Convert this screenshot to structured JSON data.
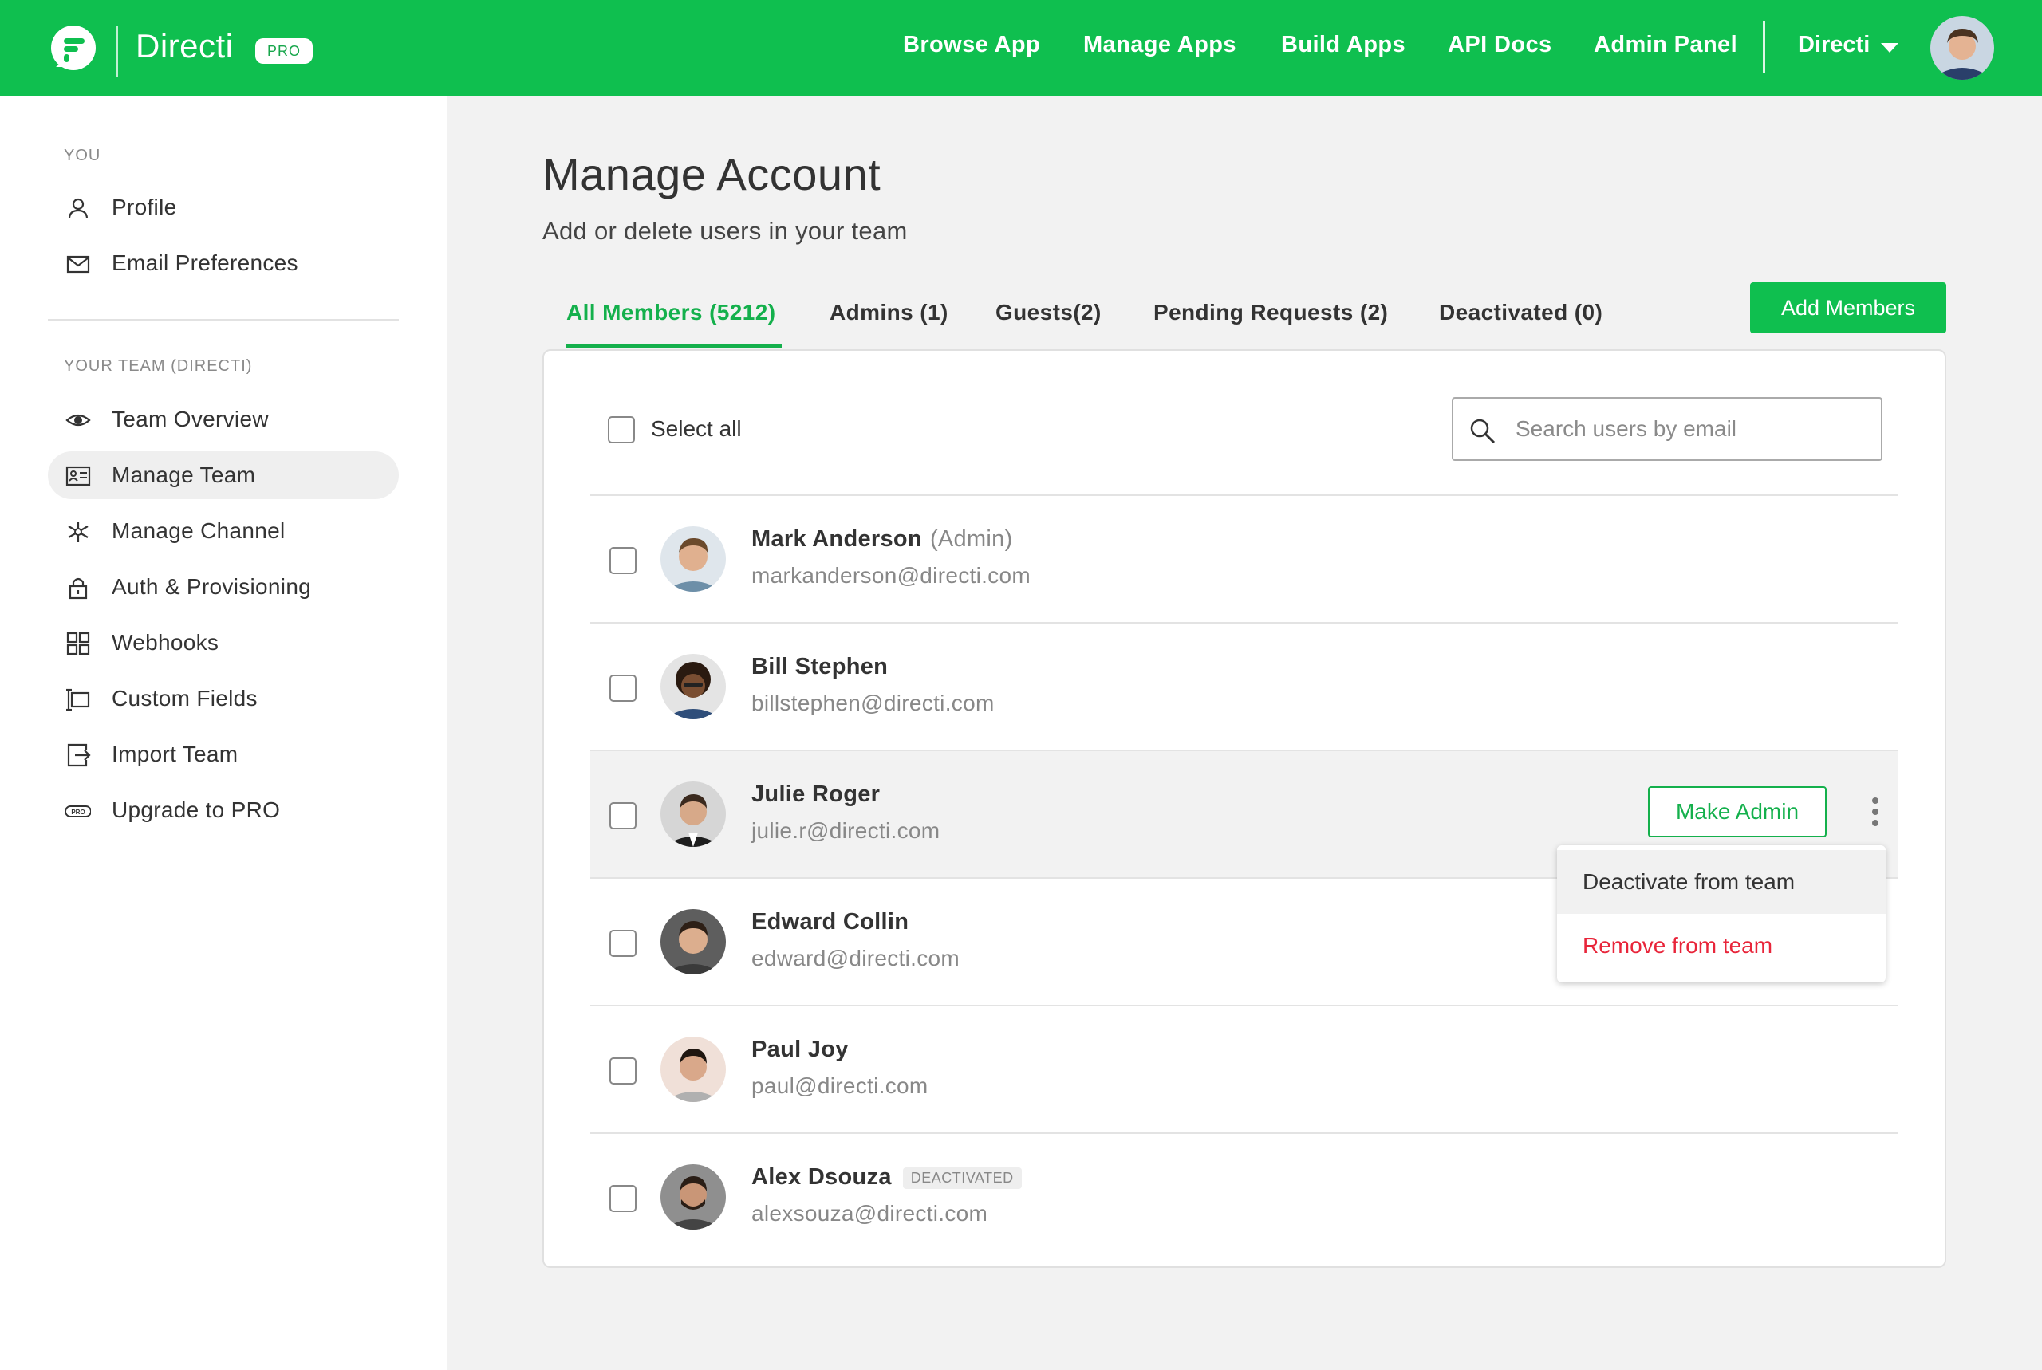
{
  "header": {
    "brand": "Directi",
    "plan_badge": "PRO",
    "nav": [
      "Browse App",
      "Manage Apps",
      "Build Apps",
      "API Docs",
      "Admin Panel"
    ],
    "org": "Directi"
  },
  "sidebar": {
    "you_label": "YOU",
    "you_items": [
      {
        "label": "Profile",
        "icon": "user-icon"
      },
      {
        "label": "Email Preferences",
        "icon": "mail-icon"
      }
    ],
    "team_label": "YOUR TEAM (DIRECTI)",
    "team_items": [
      {
        "label": "Team Overview",
        "icon": "eye-icon"
      },
      {
        "label": "Manage Team",
        "icon": "id-card-icon",
        "active": true
      },
      {
        "label": "Manage Channel",
        "icon": "asterisk-icon"
      },
      {
        "label": "Auth & Provisioning",
        "icon": "lock-icon"
      },
      {
        "label": "Webhooks",
        "icon": "grid-icon"
      },
      {
        "label": "Custom Fields",
        "icon": "custom-fields-icon"
      },
      {
        "label": "Import Team",
        "icon": "import-icon"
      },
      {
        "label": "Upgrade to PRO",
        "icon": "pro-icon"
      }
    ]
  },
  "main": {
    "title": "Manage Account",
    "subtitle": "Add or delete users in your team",
    "tabs": [
      {
        "label": "All Members (5212)",
        "active": true
      },
      {
        "label": "Admins (1)"
      },
      {
        "label": "Guests(2)"
      },
      {
        "label": "Pending Requests (2)"
      },
      {
        "label": "Deactivated (0)"
      }
    ],
    "add_button": "Add Members",
    "select_all": "Select all",
    "search_placeholder": "Search users by email",
    "members": [
      {
        "name": "Mark Anderson",
        "role": "(Admin)",
        "email": "markanderson@directi.com"
      },
      {
        "name": "Bill Stephen",
        "email": "billstephen@directi.com"
      },
      {
        "name": "Julie Roger",
        "email": "julie.r@directi.com",
        "hovered": true
      },
      {
        "name": "Edward Collin",
        "email": "edward@directi.com"
      },
      {
        "name": "Paul Joy",
        "email": "paul@directi.com"
      },
      {
        "name": "Alex Dsouza",
        "badge": "DEACTIVATED",
        "email": "alexsouza@directi.com"
      }
    ],
    "row_action": "Make Admin",
    "row_menu": [
      "Deactivate from team",
      "Remove from team"
    ]
  },
  "colors": {
    "brand_green": "#0fbf4f",
    "danger": "#e8253a"
  }
}
